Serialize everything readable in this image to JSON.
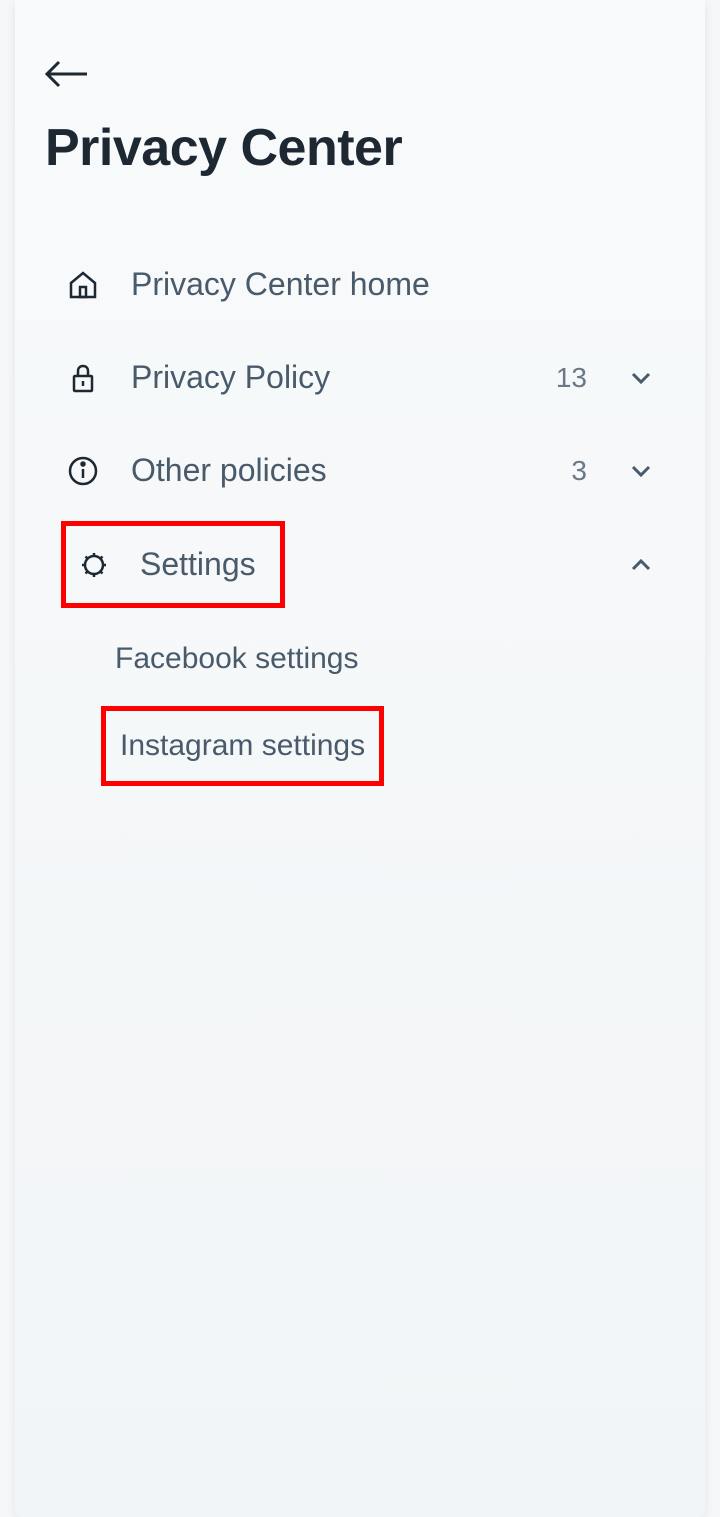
{
  "header": {
    "title": "Privacy Center"
  },
  "nav": {
    "items": [
      {
        "label": "Privacy Center home",
        "icon": "home",
        "count": null,
        "expanded": null
      },
      {
        "label": "Privacy Policy",
        "icon": "lock",
        "count": "13",
        "expanded": false
      },
      {
        "label": "Other policies",
        "icon": "info",
        "count": "3",
        "expanded": false
      },
      {
        "label": "Settings",
        "icon": "gear",
        "count": null,
        "expanded": true
      }
    ]
  },
  "settings_sub": {
    "items": [
      {
        "label": "Facebook settings"
      },
      {
        "label": "Instagram settings"
      }
    ]
  }
}
